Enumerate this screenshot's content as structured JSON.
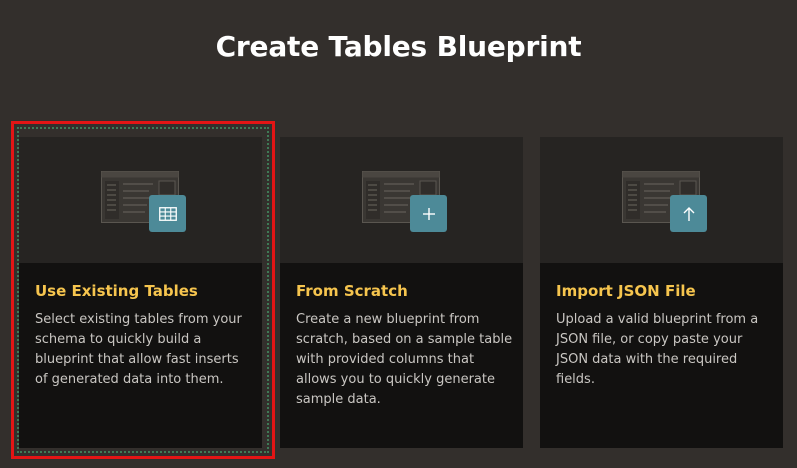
{
  "page": {
    "title": "Create Tables Blueprint"
  },
  "cards": [
    {
      "title": "Use Existing Tables",
      "description": "Select existing tables from your schema to quickly build a blueprint that allow fast inserts of generated data into them.",
      "icon": "table-grid-icon",
      "selected": true
    },
    {
      "title": "From Scratch",
      "description": "Create a new blueprint from scratch, based on a sample table with provided columns that allows you to quickly generate sample data.",
      "icon": "plus-icon",
      "selected": false
    },
    {
      "title": "Import JSON File",
      "description": "Upload a valid blueprint from a JSON file, or copy paste your JSON data with the required fields.",
      "icon": "upload-arrow-icon",
      "selected": false
    }
  ],
  "colors": {
    "background": "#332f2c",
    "card": "#121110",
    "card_media": "#262422",
    "title_accent": "#f6c54e",
    "badge": "#4d8a98",
    "selection_outline": "#e31515"
  }
}
